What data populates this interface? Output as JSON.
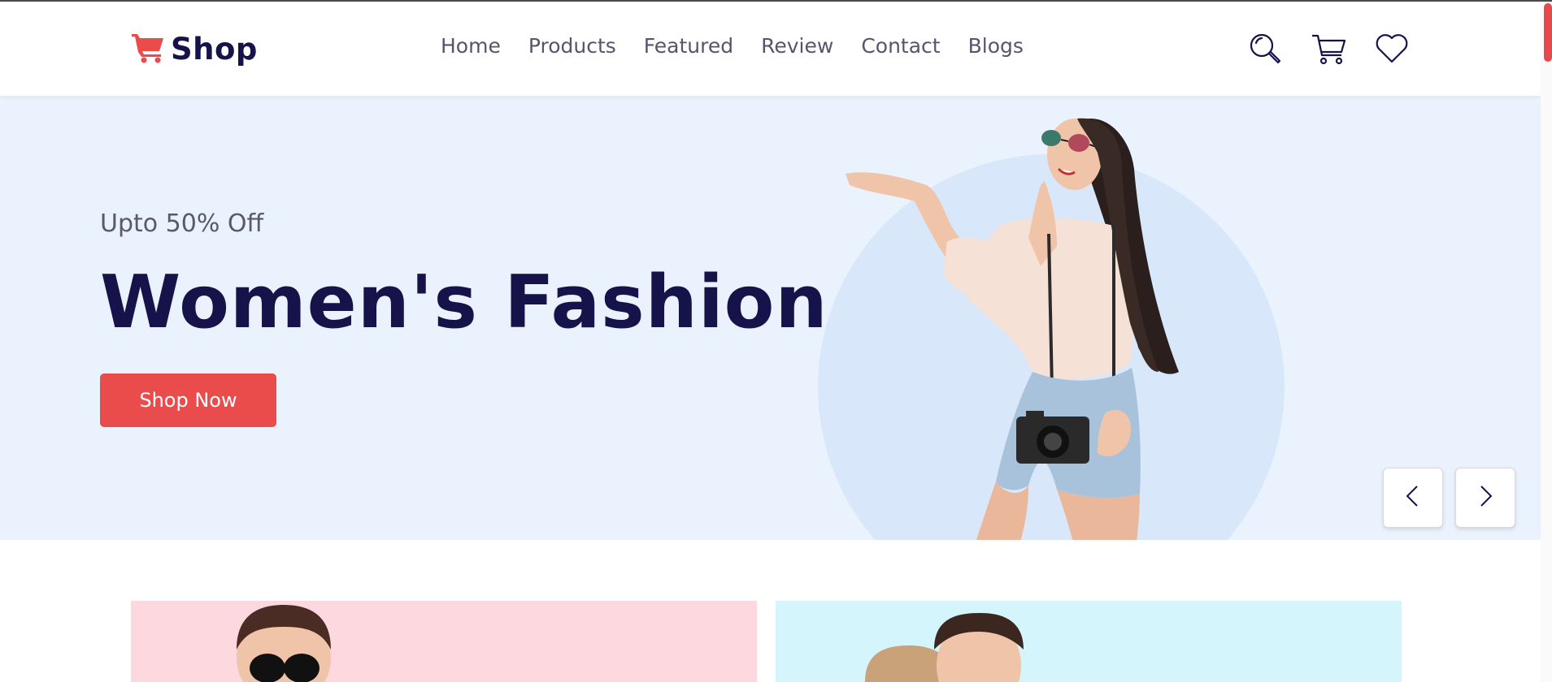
{
  "brand": {
    "name": "Shop",
    "accent_color": "#ea4b4b",
    "dark_color": "#15134a",
    "logo_icon": "shopping-cart-icon"
  },
  "nav": {
    "items": [
      {
        "label": "Home"
      },
      {
        "label": "Products"
      },
      {
        "label": "Featured"
      },
      {
        "label": "Review"
      },
      {
        "label": "Contact"
      },
      {
        "label": "Blogs"
      }
    ]
  },
  "header_icons": [
    "search-icon",
    "cart-icon",
    "heart-icon"
  ],
  "hero": {
    "subtitle": "Upto 50% Off",
    "title": "Women's Fashion",
    "cta_label": "Shop Now",
    "background": "#eaf2fd",
    "prev_icon": "chevron-left-icon",
    "next_icon": "chevron-right-icon"
  },
  "banners": [
    {
      "background": "#fdd9df"
    },
    {
      "background": "#d4f5fb"
    }
  ]
}
